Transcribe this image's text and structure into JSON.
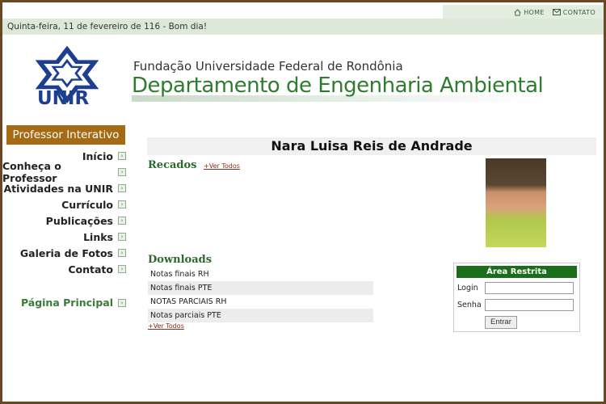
{
  "top_links": {
    "home": "HOME",
    "contato": "CONTATO"
  },
  "greeting": "Quinta-feira, 11 de fevereiro de 116 - Bom dia!",
  "header": {
    "logo_text": "UNIR",
    "foundation": "Fundação Universidade Federal de Rondônia",
    "department": "Departamento de Engenharia Ambiental"
  },
  "sidebar": {
    "title": "Professor Interativo",
    "items": [
      {
        "label": "Início"
      },
      {
        "label": "Conheça o Professor"
      },
      {
        "label": "Atividades na UNIR"
      },
      {
        "label": "Currículo"
      },
      {
        "label": "Publicações"
      },
      {
        "label": "Links"
      },
      {
        "label": "Galeria de Fotos"
      },
      {
        "label": "Contato"
      }
    ],
    "main_page": "Página Principal"
  },
  "profile": {
    "name": "Nara Luisa Reis de Andrade"
  },
  "recados": {
    "title": "Recados",
    "see_all": "+Ver Todos"
  },
  "downloads": {
    "title": "Downloads",
    "items": [
      {
        "label": "Notas finais RH"
      },
      {
        "label": "Notas finais PTE"
      },
      {
        "label": "NOTAS PARCIAIS RH"
      },
      {
        "label": "Notas parciais PTE"
      }
    ],
    "see_all": "+Ver Todos"
  },
  "login": {
    "title": "Área Restrita",
    "login_label": "Login",
    "password_label": "Senha",
    "login_value": "",
    "password_value": "",
    "button": "Entrar"
  },
  "colors": {
    "brand_green": "#2e7d2e",
    "sidebar_title_bg": "#a56a14",
    "frame_brown": "#6b4722",
    "login_header": "#1a6e1a"
  },
  "icons": {
    "home": "home-icon",
    "contato": "envelope-icon",
    "nav": "arrow-icon"
  }
}
